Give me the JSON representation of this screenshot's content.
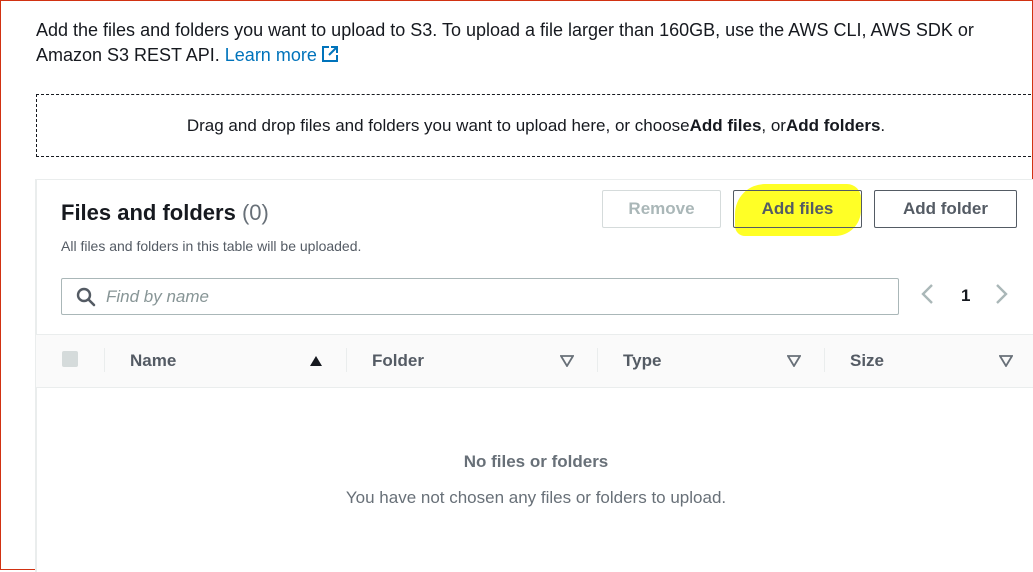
{
  "intro": {
    "text": "Add the files and folders you want to upload to S3. To upload a file larger than 160GB, use the AWS CLI, AWS SDK or Amazon S3 REST API.",
    "learn_more": "Learn more"
  },
  "dropzone": {
    "prefix": "Drag and drop files and folders you want to upload here, or choose ",
    "add_files": "Add files",
    "middle": ", or ",
    "add_folders": "Add folders",
    "suffix": "."
  },
  "panel": {
    "title": "Files and folders",
    "count": "(0)",
    "subtitle": "All files and folders in this table will be uploaded.",
    "buttons": {
      "remove": "Remove",
      "add_files": "Add files",
      "add_folder": "Add folder"
    },
    "search_placeholder": "Find by name",
    "page_number": "1"
  },
  "table": {
    "columns": [
      "Name",
      "Folder",
      "Type",
      "Size"
    ],
    "empty_title": "No files or folders",
    "empty_message": "You have not chosen any files or folders to upload."
  },
  "colors": {
    "link": "#0073bb",
    "highlight": "#ffff00",
    "frame_border": "#d13212"
  }
}
